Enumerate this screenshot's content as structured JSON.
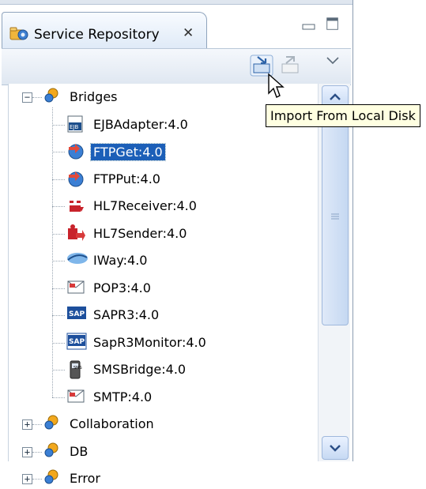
{
  "view": {
    "title": "Service Repository",
    "close_glyph": "✕",
    "minimize_glyph": "▭",
    "maximize_glyph": "☐"
  },
  "toolbar": {
    "import_button_icon": "import-icon",
    "export_button_icon": "export-icon",
    "view_menu_icon": "chevron-down-icon"
  },
  "tooltip": {
    "text": "Import From Local Disk"
  },
  "tree": {
    "groups": [
      {
        "label": "Bridges",
        "expanded": true,
        "children": [
          {
            "label": "EJBAdapter:4.0",
            "icon": "ejb-icon"
          },
          {
            "label": "FTPGet:4.0",
            "icon": "ftp-get-icon",
            "selected": true
          },
          {
            "label": "FTPPut:4.0",
            "icon": "ftp-put-icon"
          },
          {
            "label": "HL7Receiver:4.0",
            "icon": "hl7-receiver-icon"
          },
          {
            "label": "HL7Sender:4.0",
            "icon": "hl7-sender-icon"
          },
          {
            "label": "IWay:4.0",
            "icon": "iway-icon"
          },
          {
            "label": "POP3:4.0",
            "icon": "pop3-icon"
          },
          {
            "label": "SAPR3:4.0",
            "icon": "sap-icon"
          },
          {
            "label": "SapR3Monitor:4.0",
            "icon": "sap-monitor-icon"
          },
          {
            "label": "SMSBridge:4.0",
            "icon": "sms-icon"
          },
          {
            "label": "SMTP:4.0",
            "icon": "smtp-icon"
          }
        ]
      },
      {
        "label": "Collaboration",
        "expanded": false
      },
      {
        "label": "DB",
        "expanded": false
      },
      {
        "label": "Error",
        "expanded": false
      }
    ]
  },
  "colors": {
    "selection": "#1c5fb8",
    "tooltip_bg": "#ffffe1",
    "frame_border": "#8a9cb1"
  }
}
